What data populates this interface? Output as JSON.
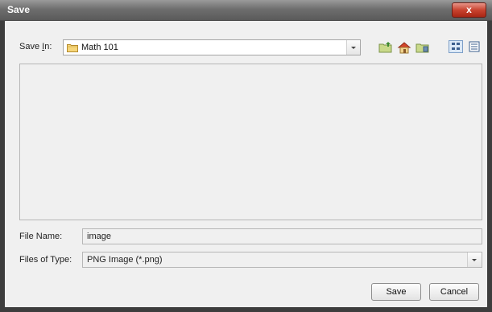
{
  "window": {
    "title": "Save",
    "close_symbol": "x"
  },
  "save_in": {
    "label_pre": "Save ",
    "label_mnemonic": "I",
    "label_post": "n:",
    "value": "Math 101"
  },
  "toolbar": {
    "icons": [
      "up-folder-icon",
      "home-icon",
      "new-folder-icon",
      "list-view-icon",
      "details-view-icon"
    ]
  },
  "file_name": {
    "label": "File Name:",
    "value": "image"
  },
  "files_of_type": {
    "label": "Files of Type:",
    "value": "PNG Image (*.png)"
  },
  "buttons": {
    "save": "Save",
    "cancel": "Cancel"
  }
}
